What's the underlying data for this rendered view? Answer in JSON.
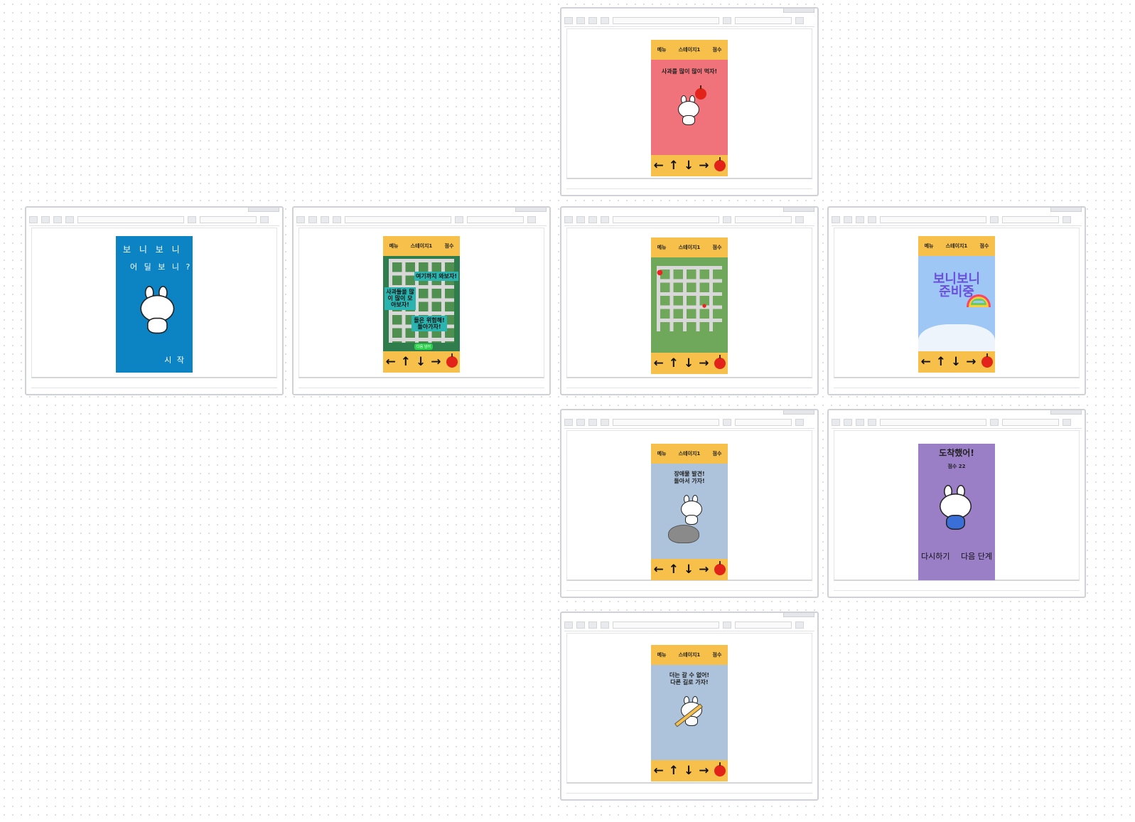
{
  "nav": {
    "menu": "메뉴",
    "stage": "스테이지1",
    "score": "점수"
  },
  "controls": {
    "left": "←",
    "up": "↑",
    "down": "↓",
    "right": "→",
    "apple_icon": "apple-icon"
  },
  "screens": {
    "start": {
      "line1": "보 니 보 니",
      "line2": "어 딜 보 니 ?",
      "start_label": "시 작",
      "bg": "#0c83c3"
    },
    "apple_intro": {
      "caption": "사과를 많이 많이 먹자!",
      "bg": "#f0727a"
    },
    "tutorial": {
      "bubble1": "여기까지 와보자!",
      "bubble2": "사과들을 많이 많이 모아보자!",
      "bubble3": "돌은 위험해! 돌아가자!",
      "button": "다음 넘어"
    },
    "map": {
      "bg": "#6fa85a"
    },
    "ready": {
      "logo_top": "보니보니",
      "logo_bottom": "준비중",
      "bg": "#9ec7f5"
    },
    "obstacle": {
      "line1": "장애물 발견!",
      "line2": "돌아서 가자!",
      "bg": "#adc3db"
    },
    "arrived": {
      "title": "도착했어!",
      "score": "점수 22",
      "retry": "다시하기",
      "next": "다음 단계",
      "bg": "#9a7fc6"
    },
    "deadend": {
      "line1": "더는 갈 수 없어!",
      "line2": "다른 길로 가자!",
      "bg": "#adc3db"
    }
  }
}
